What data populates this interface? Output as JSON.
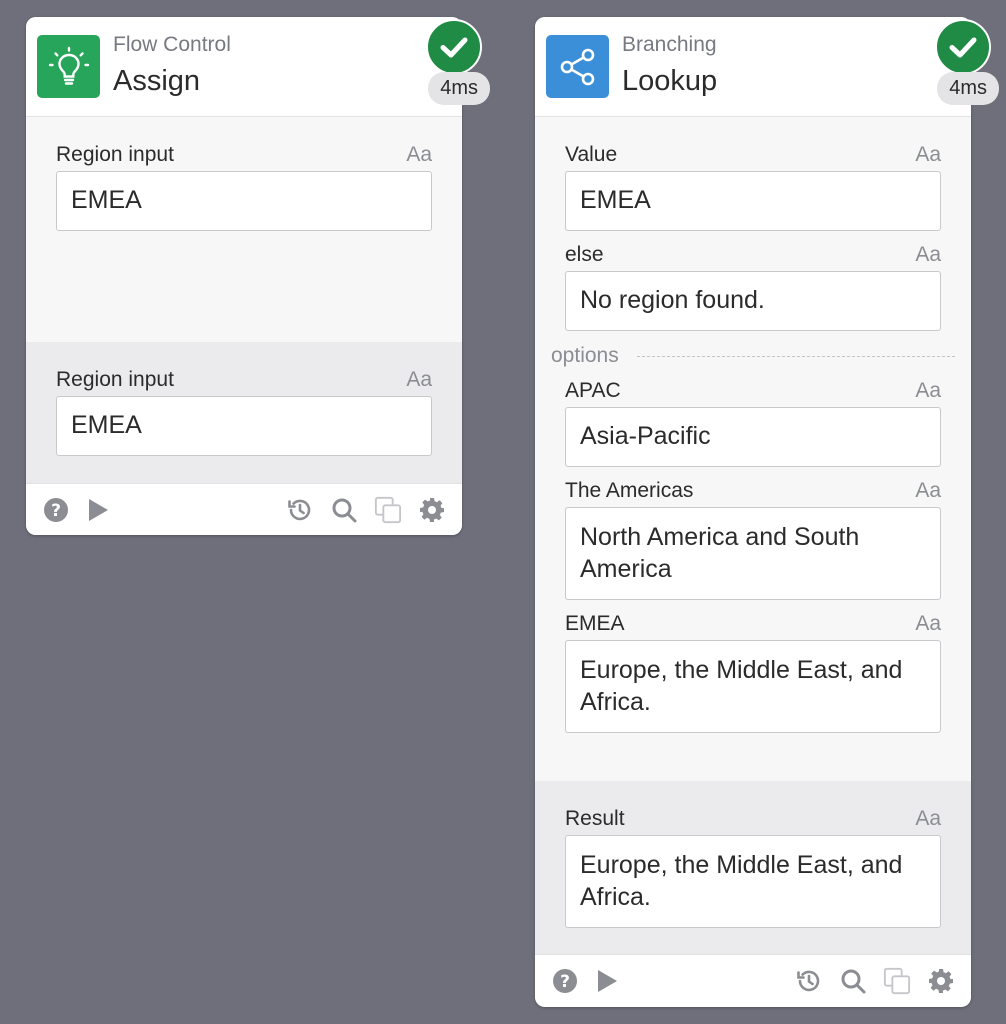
{
  "colors": {
    "canvas": "#6e6f7a",
    "assign_icon_bg": "#27a55a",
    "lookup_icon_bg": "#3b8fd8",
    "success": "#1f8b44"
  },
  "cards": {
    "assign": {
      "category": "Flow Control",
      "title": "Assign",
      "icon": "lightbulb-icon",
      "status_icon": "check-icon",
      "duration": "4ms",
      "input_field": {
        "label": "Region input",
        "type_badge": "Aa",
        "value": "EMEA"
      },
      "output_field": {
        "label": "Region input",
        "type_badge": "Aa",
        "value": "EMEA"
      }
    },
    "lookup": {
      "category": "Branching",
      "title": "Lookup",
      "icon": "share-icon",
      "status_icon": "check-icon",
      "duration": "4ms",
      "value_field": {
        "label": "Value",
        "type_badge": "Aa",
        "value": "EMEA"
      },
      "else_field": {
        "label": "else",
        "type_badge": "Aa",
        "value": "No region found."
      },
      "options_label": "options",
      "options": [
        {
          "label": "APAC",
          "type_badge": "Aa",
          "value": "Asia-Pacific"
        },
        {
          "label": "The Americas",
          "type_badge": "Aa",
          "value": "North America and South America"
        },
        {
          "label": "EMEA",
          "type_badge": "Aa",
          "value": "Europe, the Middle East, and Africa."
        }
      ],
      "result_field": {
        "label": "Result",
        "type_badge": "Aa",
        "value": "Europe, the Middle East, and Africa."
      }
    }
  },
  "footer_icons": [
    "help-icon",
    "play-icon",
    "history-icon",
    "search-icon",
    "copy-icon",
    "gear-icon"
  ]
}
